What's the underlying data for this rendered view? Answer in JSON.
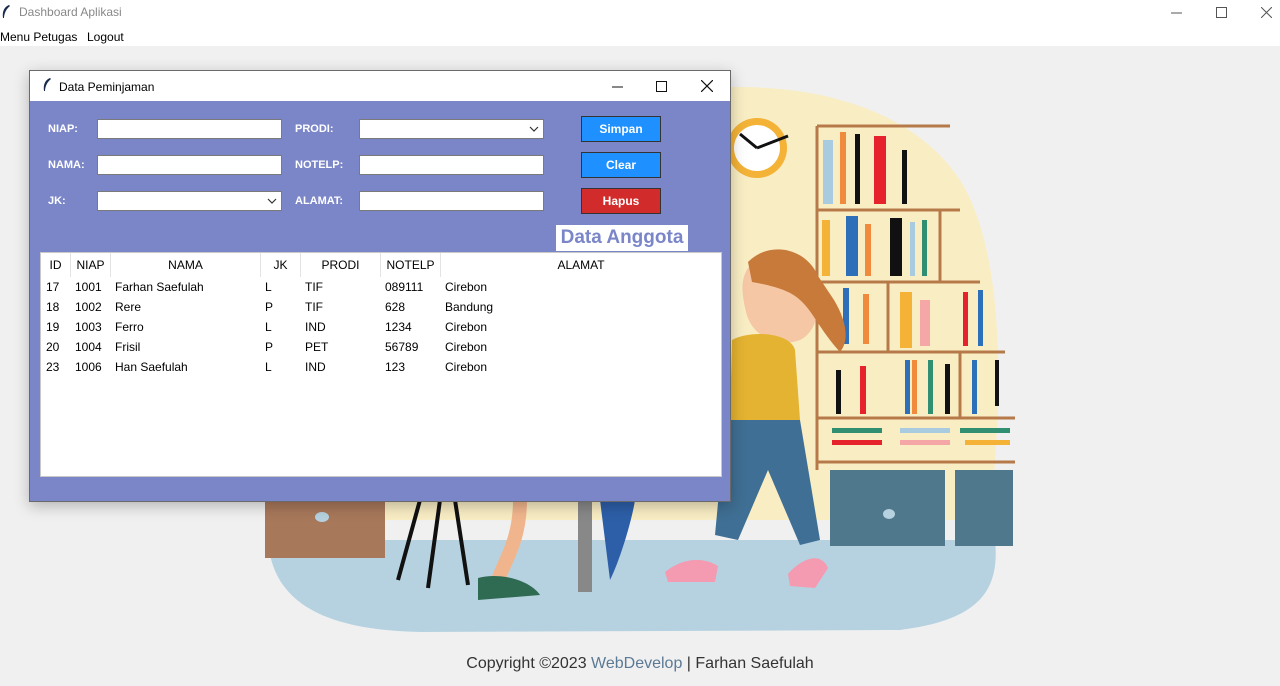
{
  "window": {
    "title": "Dashboard Aplikasi",
    "controls": [
      "minimize-icon",
      "maximize-icon",
      "close-icon"
    ]
  },
  "menubar": {
    "items": [
      {
        "label": "Menu Petugas"
      },
      {
        "label": "Logout"
      }
    ]
  },
  "footer": {
    "prefix": "Copyright ©2023 ",
    "link": "WebDevelop",
    "suffix": " | Farhan Saefulah"
  },
  "dialog": {
    "title": "Data Peminjaman",
    "form": {
      "niap_label": "NIAP:",
      "nama_label": "NAMA:",
      "jk_label": "JK:",
      "prodi_label": "PRODI:",
      "notelp_label": "NOTELP:",
      "alamat_label": "ALAMAT:",
      "niap_value": "",
      "nama_value": "",
      "jk_value": "",
      "prodi_value": "",
      "notelp_value": "",
      "alamat_value": ""
    },
    "buttons": {
      "simpan": "Simpan",
      "clear": "Clear",
      "hapus": "Hapus"
    },
    "section_title": "Data Anggota",
    "table": {
      "columns": [
        "ID",
        "NIAP",
        "NAMA",
        "JK",
        "PRODI",
        "NOTELP",
        "ALAMAT"
      ],
      "rows": [
        [
          "17",
          "1001",
          "Farhan Saefulah",
          "L",
          "TIF",
          "089111",
          "Cirebon"
        ],
        [
          "18",
          "1002",
          "Rere",
          "P",
          "TIF",
          "628",
          "Bandung"
        ],
        [
          "19",
          "1003",
          "Ferro",
          "L",
          "IND",
          "1234",
          "Cirebon"
        ],
        [
          "20",
          "1004",
          "Frisil",
          "P",
          "PET",
          "56789",
          "Cirebon"
        ],
        [
          "23",
          "1006",
          "Han Saefulah",
          "L",
          "IND",
          "123",
          "Cirebon"
        ]
      ]
    }
  },
  "colors": {
    "dialog_bg": "#7b86c9",
    "button_blue": "#1e90ff",
    "button_red": "#d22b2b"
  }
}
